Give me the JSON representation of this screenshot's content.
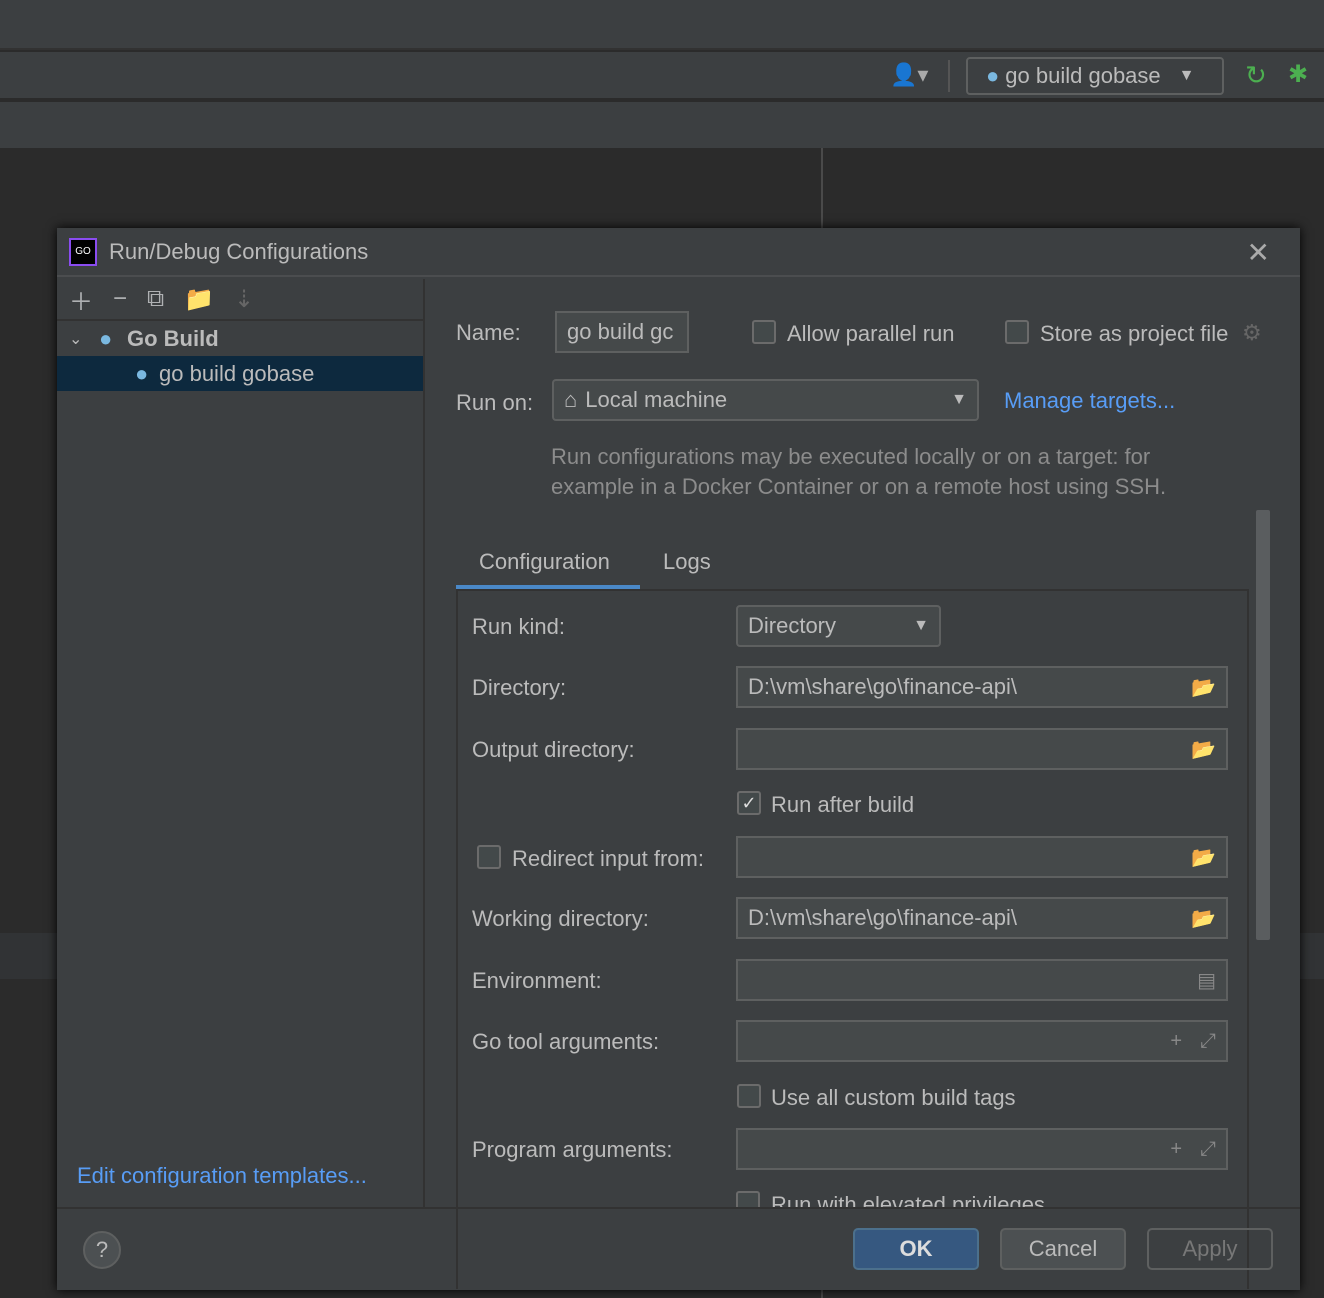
{
  "toolbar": {
    "run_config": "go build gobase"
  },
  "dialog": {
    "title": "Run/Debug Configurations",
    "tree": {
      "group": "Go Build",
      "item": "go build gobase"
    },
    "edit_templates": "Edit configuration templates...",
    "name_label": "Name:",
    "name_value": "go build gc",
    "allow_parallel": "Allow parallel run",
    "allow_parallel_checked": false,
    "store_project": "Store as project file",
    "store_project_checked": false,
    "run_on_label": "Run on:",
    "run_on_value": "Local machine",
    "manage_targets": "Manage targets...",
    "hint": "Run configurations may be executed locally or on a target: for example in a Docker Container or on a remote host using SSH.",
    "tabs": [
      {
        "label": "Configuration",
        "active": true
      },
      {
        "label": "Logs",
        "active": false
      }
    ],
    "fields": {
      "run_kind_label": "Run kind:",
      "run_kind_value": "Directory",
      "directory_label": "Directory:",
      "directory_value": "D:\\vm\\share\\go\\finance-api\\",
      "output_label": "Output directory:",
      "output_value": "",
      "run_after_build": "Run after build",
      "run_after_build_checked": true,
      "redirect_label": "Redirect input from:",
      "redirect_checked": false,
      "working_label": "Working directory:",
      "working_value": "D:\\vm\\share\\go\\finance-api\\",
      "env_label": "Environment:",
      "gotool_label": "Go tool arguments:",
      "custom_tags": "Use all custom build tags",
      "custom_tags_checked": false,
      "program_label": "Program arguments:",
      "elevated": "Run with elevated privileges"
    },
    "buttons": {
      "ok": "OK",
      "cancel": "Cancel",
      "apply": "Apply",
      "help": "?"
    }
  }
}
